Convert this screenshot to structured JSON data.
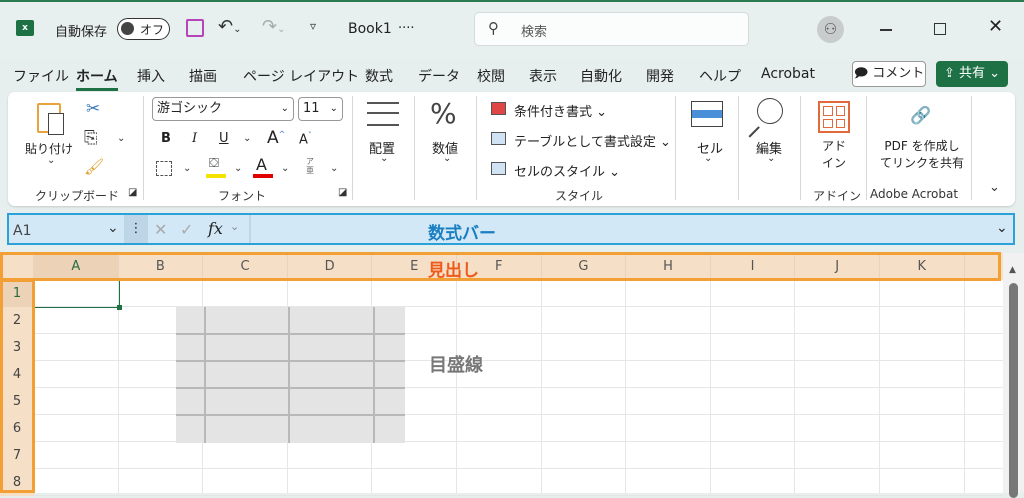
{
  "titlebar": {
    "autosave_label": "自動保存",
    "autosave_state": "オフ",
    "workbook": "Book1",
    "workbook_more": "····",
    "search_placeholder": "検索",
    "app_icon": "excel-icon"
  },
  "menu": {
    "items": [
      "ファイル",
      "ホーム",
      "挿入",
      "描画",
      "ページ レイアウト",
      "数式",
      "データ",
      "校閲",
      "表示",
      "自動化",
      "開発",
      "ヘルプ",
      "Acrobat"
    ],
    "active": "ホーム",
    "comment": "コメント",
    "share": "共有"
  },
  "ribbon": {
    "clipboard": {
      "paste": "貼り付け",
      "group": "クリップボード"
    },
    "font": {
      "name": "游ゴシック",
      "size": "11",
      "bold": "B",
      "italic": "I",
      "underline": "U",
      "grow": "A",
      "shrink": "A",
      "color": "A",
      "phonetic": "ア亜",
      "group": "フォント",
      "highlight_color": "#f5e400",
      "font_color": "#e00000"
    },
    "alignment": {
      "label": "配置"
    },
    "number": {
      "label": "数値",
      "icon": "%"
    },
    "styles": {
      "conditional": "条件付き書式",
      "table": "テーブルとして書式設定",
      "cell_styles": "セルのスタイル",
      "group": "スタイル"
    },
    "cells": {
      "label": "セル"
    },
    "editing": {
      "label": "編集"
    },
    "addins": {
      "label1": "アド",
      "label2": "イン",
      "group": "アドイン"
    },
    "acrobat": {
      "line1": "PDF を作成し",
      "line2": "てリンクを共有",
      "group": "Adobe Acrobat"
    }
  },
  "formula_bar": {
    "name_box": "A1",
    "fx": "fx",
    "content": ""
  },
  "sheet": {
    "columns": [
      "A",
      "B",
      "C",
      "D",
      "E",
      "F",
      "G",
      "H",
      "I",
      "J",
      "K"
    ],
    "rows": [
      "1",
      "2",
      "3",
      "4",
      "5",
      "6",
      "7",
      "8"
    ],
    "selected_cell": "A1"
  },
  "annotations": {
    "formula_bar": "数式バー",
    "headings": "見出し",
    "gridlines": "目盛線",
    "formula_color": "#1a7fc1",
    "headings_color": "#ee5a1a",
    "gridlines_color": "#777777"
  }
}
